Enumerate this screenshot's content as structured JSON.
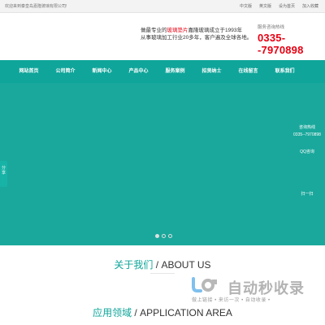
{
  "topbar": {
    "welcome": "欢迎来到秦皇岛嘉隆玻璃有限公司!",
    "links": [
      "中文版",
      "英文版",
      "设为首页",
      "加入收藏"
    ]
  },
  "header": {
    "slogan_prefix": "做最专业的",
    "slogan_highlight": "玻璃垫片",
    "slogan_rest": "嘉隆玻璃成立于1993年",
    "slogan_line2": "从事玻璃加工行业20多年，客户遍及全球各地。",
    "hotline_label": "服务咨询热线",
    "hotline_number": "0335--7970898"
  },
  "nav": {
    "items": [
      "网站首页",
      "公司简介",
      "新闻中心",
      "产品中心",
      "服务案例",
      "招贤纳士",
      "在线留言",
      "联系我们"
    ]
  },
  "banner": {
    "left_tab": "分享",
    "dots": [
      true,
      false,
      false
    ]
  },
  "float_service": {
    "title": "咨询热线",
    "number": "0335--7970898",
    "qq": "QQ咨询",
    "pager": "扫一扫"
  },
  "about": {
    "cn": "关于我们",
    "en": " / ABOUT US"
  },
  "application": {
    "cn": "应用领域",
    "en": " / APPLICATION AREA"
  },
  "watermark": {
    "title": "自动秒收录",
    "sub": "做上链接 • 来访一次 • 自动收录 •"
  },
  "colors": {
    "accent": "#0fa59a",
    "banner": "#1aa89c",
    "hotline": "#e60012"
  }
}
